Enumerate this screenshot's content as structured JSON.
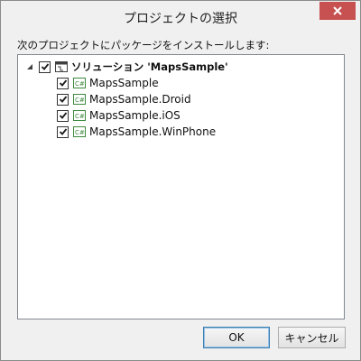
{
  "window": {
    "title": "プロジェクトの選択"
  },
  "prompt": "次のプロジェクトにパッケージをインストールします:",
  "tree": {
    "solution": {
      "label": "ソリューション 'MapsSample'",
      "checked": true,
      "expanded": true
    },
    "projects": [
      {
        "label": "MapsSample",
        "checked": true,
        "icon": "csharp-project-icon"
      },
      {
        "label": "MapsSample.Droid",
        "checked": true,
        "icon": "csharp-project-icon"
      },
      {
        "label": "MapsSample.iOS",
        "checked": true,
        "icon": "csharp-project-icon"
      },
      {
        "label": "MapsSample.WinPhone",
        "checked": true,
        "icon": "csharp-project-icon"
      }
    ]
  },
  "buttons": {
    "ok": "OK",
    "cancel": "キャンセル"
  },
  "colors": {
    "close": "#c75050",
    "checkmark": "#1a1a1a",
    "csharp_icon": "#3d8a3d"
  }
}
